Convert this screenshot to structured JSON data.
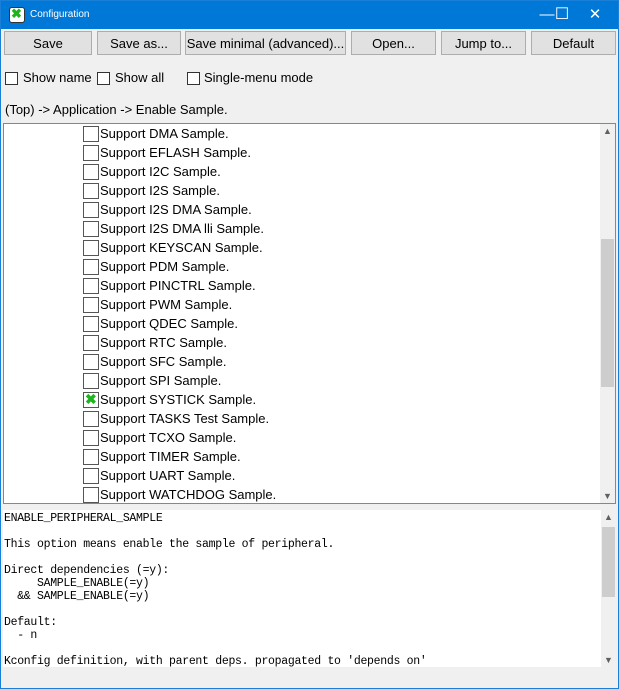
{
  "window": {
    "title": "Configuration",
    "minimize": "—",
    "maximize": "☐",
    "close": "✕"
  },
  "toolbar": {
    "save": "Save",
    "save_as": "Save as...",
    "save_minimal": "Save minimal (advanced)...",
    "open": "Open...",
    "jump_to": "Jump to...",
    "default": "Default"
  },
  "options": {
    "show_name": "Show name",
    "show_all": "Show all",
    "single_menu": "Single-menu mode"
  },
  "breadcrumb": "(Top) -> Application -> Enable Sample.",
  "tree": {
    "items": [
      {
        "label": "Support DMA Sample.",
        "checked": false
      },
      {
        "label": "Support EFLASH Sample.",
        "checked": false
      },
      {
        "label": "Support I2C Sample.",
        "checked": false
      },
      {
        "label": "Support I2S Sample.",
        "checked": false
      },
      {
        "label": "Support I2S DMA Sample.",
        "checked": false
      },
      {
        "label": "Support I2S DMA lli Sample.",
        "checked": false
      },
      {
        "label": "Support KEYSCAN Sample.",
        "checked": false
      },
      {
        "label": "Support PDM Sample.",
        "checked": false
      },
      {
        "label": "Support PINCTRL Sample.",
        "checked": false
      },
      {
        "label": "Support PWM Sample.",
        "checked": false
      },
      {
        "label": "Support QDEC Sample.",
        "checked": false
      },
      {
        "label": "Support RTC Sample.",
        "checked": false
      },
      {
        "label": "Support SFC Sample.",
        "checked": false
      },
      {
        "label": "Support SPI Sample.",
        "checked": false
      },
      {
        "label": "Support SYSTICK Sample.",
        "checked": true
      },
      {
        "label": "Support TASKS Test Sample.",
        "checked": false
      },
      {
        "label": "Support TCXO Sample.",
        "checked": false
      },
      {
        "label": "Support TIMER Sample.",
        "checked": false
      },
      {
        "label": "Support UART Sample.",
        "checked": false
      },
      {
        "label": "Support WATCHDOG Sample.",
        "checked": false
      }
    ]
  },
  "info": {
    "text": "ENABLE_PERIPHERAL_SAMPLE\n\nThis option means enable the sample of peripheral.\n\nDirect dependencies (=y):\n     SAMPLE_ENABLE(=y)\n  && SAMPLE_ENABLE(=y)\n\nDefault:\n  - n\n\nKconfig definition, with parent deps. propagated to 'depends on'"
  },
  "colors": {
    "titlebar": "#0078d7",
    "check": "#1db41d"
  }
}
